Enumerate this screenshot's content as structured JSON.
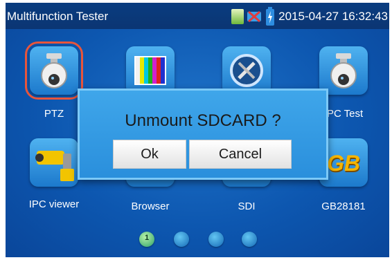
{
  "status_bar": {
    "title": "Multifunction Tester",
    "datetime": "2015-04-27 16:32:43",
    "icons": [
      "sd-card-icon",
      "network-disconnected-icon",
      "battery-charging-icon"
    ]
  },
  "apps": [
    {
      "label": "PTZ",
      "icon": "ptz-camera-icon",
      "selected": true
    },
    {
      "label": "",
      "icon": "color-bar-icon"
    },
    {
      "label": "",
      "icon": "tools-icon"
    },
    {
      "label": "IPC Test",
      "icon": "ipc-camera-icon"
    },
    {
      "label": "IPC viewer",
      "icon": "ipc-viewer-icon"
    },
    {
      "label": "Browser",
      "icon": "browser-icon"
    },
    {
      "label": "SDI",
      "icon": "sdi-icon"
    },
    {
      "label": "GB28181",
      "icon": "gb28181-icon",
      "icon_text": "GB"
    }
  ],
  "dialog": {
    "message": "Unmount SDCARD ?",
    "ok_label": "Ok",
    "cancel_label": "Cancel"
  },
  "pager": {
    "current_page": "1",
    "page_count": 4
  },
  "colors": {
    "background": "#0d57b0",
    "status_bar": "#0b3573",
    "selection_outline": "#e8553b",
    "dialog": "#3fa6ea"
  }
}
